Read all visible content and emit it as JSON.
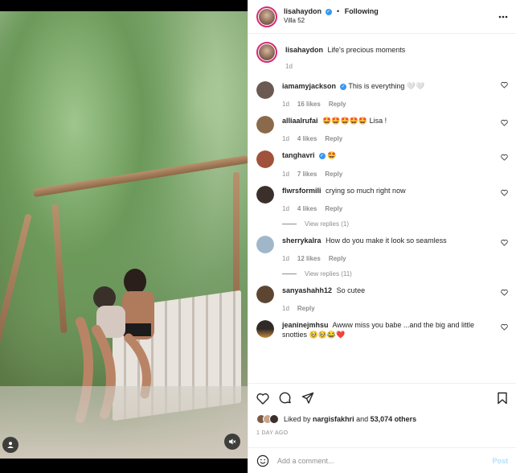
{
  "post": {
    "author": "lisahaydon",
    "location": "Villa 52",
    "follow_status": "Following",
    "dot": "•",
    "caption": "Life's precious moments",
    "caption_age": "1d"
  },
  "comments": [
    {
      "user": "iamamyjackson",
      "verified": true,
      "text": "This is everything 🤍🤍",
      "age": "1d",
      "likes": "16 likes",
      "reply": "Reply",
      "color": "#6b5a52"
    },
    {
      "user": "alliaalrufai",
      "verified": false,
      "text": "🤩🤩🤩🤩🤩 Lisa !",
      "age": "1d",
      "likes": "4 likes",
      "reply": "Reply",
      "color": "#8a6a4a"
    },
    {
      "user": "tanghavri",
      "verified": true,
      "text": "🤩",
      "age": "1d",
      "likes": "7 likes",
      "reply": "Reply",
      "color": "#a0523a"
    },
    {
      "user": "flwrsformili",
      "verified": false,
      "text": "crying so much right now",
      "age": "1d",
      "likes": "4 likes",
      "reply": "Reply",
      "color": "#3b2f2c",
      "view_replies": "View replies (1)"
    },
    {
      "user": "sherrykalra",
      "verified": false,
      "text": "How do you make it look so seamless",
      "age": "1d",
      "likes": "12 likes",
      "reply": "Reply",
      "color": "#9fb7c9",
      "view_replies": "View replies (11)"
    },
    {
      "user": "sanyashahh12",
      "verified": false,
      "text": "So cutee",
      "age": "1d",
      "likes": "",
      "reply": "Reply",
      "color": "#5c4632"
    },
    {
      "user": "jeaninejmhsu",
      "verified": false,
      "text": "Awww miss you babe ...and the big and little snotties 🥹🥹😂❤️",
      "age": "",
      "likes": "",
      "reply": "",
      "color": "#2f2a28"
    }
  ],
  "actions": {
    "liked_by_prefix": "Liked by",
    "liked_by_user": "nargisfakhri",
    "liked_by_and": "and",
    "others": "53,074 others",
    "date": "1 DAY AGO"
  },
  "add_comment": {
    "placeholder": "Add a comment...",
    "post_label": "Post"
  },
  "colors": {
    "verified": "#3897f0",
    "story_ring": "#d62976",
    "muted": "#8e8e8e",
    "post_disabled": "#b2dffc"
  }
}
